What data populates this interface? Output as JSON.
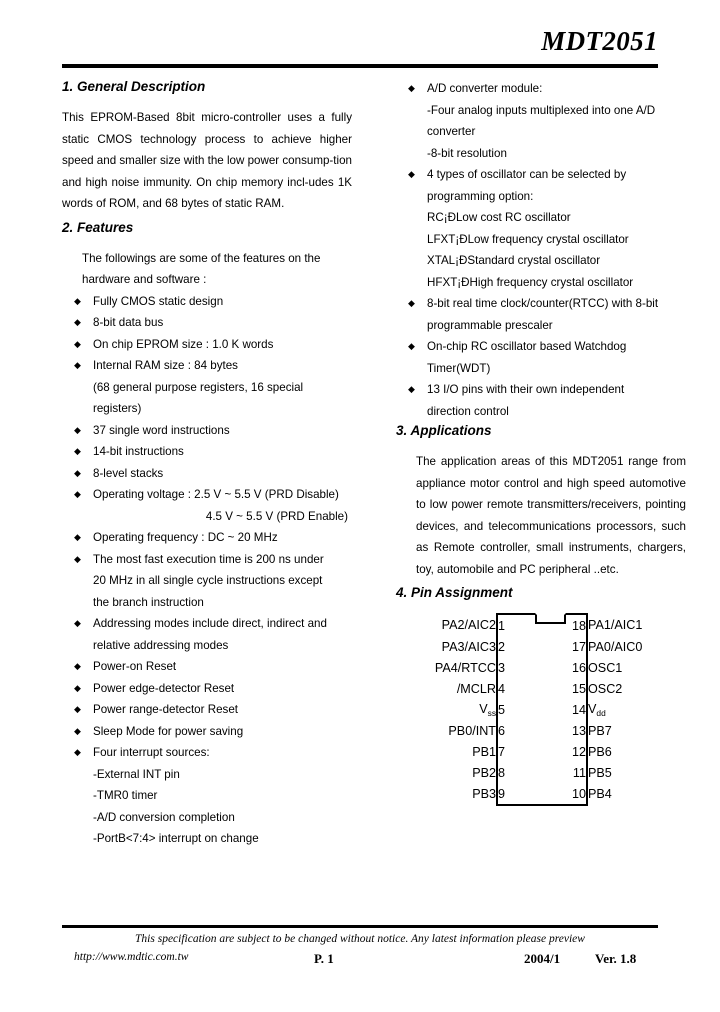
{
  "header": {
    "doc_title": "MDT2051"
  },
  "sections": {
    "general_description": {
      "heading": "1. General Description",
      "paragraph": "This EPROM-Based 8bit micro-controller uses a fully static CMOS technology process to achieve higher speed and smaller size with the low power consump-tion and high noise immunity. On chip memory incl-udes 1K words of ROM, and 68 bytes of static RAM."
    },
    "features": {
      "heading": "2. Features",
      "intro_line1": "The followings are some of the features on the",
      "intro_line2": "hardware and software :",
      "items_left": [
        {
          "type": "bullet",
          "text": "Fully CMOS static design"
        },
        {
          "type": "bullet",
          "text": "8-bit data bus"
        },
        {
          "type": "bullet",
          "text": "On chip EPROM size : 1.0 K words"
        },
        {
          "type": "bullet",
          "text": "Internal RAM size : 84 bytes"
        },
        {
          "type": "sub",
          "text": "(68 general purpose registers, 16 special"
        },
        {
          "type": "sub",
          "text": "registers)"
        },
        {
          "type": "bullet",
          "text": "37 single word instructions"
        },
        {
          "type": "bullet",
          "text": "14-bit instructions"
        },
        {
          "type": "bullet",
          "text": "8-level stacks"
        },
        {
          "type": "bullet",
          "text": "Operating voltage : 2.5 V ~ 5.5 V (PRD Disable)"
        },
        {
          "type": "right",
          "text": "4.5 V ~ 5.5 V (PRD Enable)"
        },
        {
          "type": "bullet",
          "text": "Operating frequency : DC ~ 20 MHz"
        },
        {
          "type": "bullet-justified",
          "text": "The most fast execution time is 200 ns under"
        },
        {
          "type": "cont-justified",
          "text": "20 MHz in all single cycle instructions except"
        },
        {
          "type": "cont",
          "text": "the branch instruction"
        },
        {
          "type": "bullet-justified",
          "text": "Addressing modes include direct, indirect and"
        },
        {
          "type": "cont",
          "text": "relative addressing modes"
        },
        {
          "type": "bullet",
          "text": "Power-on Reset"
        },
        {
          "type": "bullet",
          "text": "Power edge-detector Reset"
        },
        {
          "type": "bullet",
          "text": "Power range-detector Reset"
        },
        {
          "type": "bullet",
          "text": "Sleep Mode for power saving"
        },
        {
          "type": "bullet",
          "text": "Four interrupt sources:"
        },
        {
          "type": "sub",
          "text": "-External INT pin"
        },
        {
          "type": "sub",
          "text": "-TMR0 timer"
        },
        {
          "type": "sub",
          "text": "-A/D conversion completion"
        },
        {
          "type": "sub",
          "text": "-PortB<7:4> interrupt on change"
        }
      ],
      "items_right": [
        {
          "type": "bullet",
          "text": "A/D converter module:"
        },
        {
          "type": "sub",
          "text": "-Four analog inputs multiplexed into one A/D"
        },
        {
          "type": "sub",
          "text": "converter"
        },
        {
          "type": "sub",
          "text": "-8-bit resolution"
        },
        {
          "type": "bullet",
          "text": "4 types of oscillator can be selected by"
        },
        {
          "type": "cont",
          "text": "programming option:"
        },
        {
          "type": "cont",
          "text": "RC¡ÐLow cost RC oscillator"
        },
        {
          "type": "cont",
          "text": "LFXT¡ÐLow frequency crystal oscillator"
        },
        {
          "type": "cont",
          "text": "XTAL¡ÐStandard crystal oscillator"
        },
        {
          "type": "cont",
          "text": "HFXT¡ÐHigh frequency crystal oscillator"
        },
        {
          "type": "bullet",
          "text": "8-bit real time clock/counter(RTCC) with 8-bit"
        },
        {
          "type": "cont",
          "text": "programmable prescaler"
        },
        {
          "type": "bullet",
          "text": "On-chip RC oscillator based Watchdog"
        },
        {
          "type": "cont",
          "text": "Timer(WDT)"
        },
        {
          "type": "bullet",
          "text": "13 I/O pins with their own independent"
        },
        {
          "type": "cont",
          "text": "direction control"
        }
      ]
    },
    "applications": {
      "heading": "3. Applications",
      "paragraph": "The application areas of this MDT2051 range from appliance motor control and high speed automotive to low power remote transmitters/receivers, pointing devices, and telecommunications processors, such as Remote controller, small instruments, chargers, toy, automobile and PC peripheral ..etc."
    },
    "pin_assignment": {
      "heading": "4. Pin Assignment",
      "rows": [
        {
          "left_label": "PA2/AIC2",
          "left_pin": "1",
          "right_pin": "18",
          "right_label": "PA1/AIC1"
        },
        {
          "left_label": "PA3/AIC3",
          "left_pin": "2",
          "right_pin": "17",
          "right_label": "PA0/AIC0"
        },
        {
          "left_label": "PA4/RTCC",
          "left_pin": "3",
          "right_pin": "16",
          "right_label": "OSC1"
        },
        {
          "left_label": "/MCLR",
          "left_pin": "4",
          "right_pin": "15",
          "right_label": "OSC2"
        },
        {
          "left_label": "Vss",
          "left_pin": "5",
          "right_pin": "14",
          "right_label": "Vdd"
        },
        {
          "left_label": "PB0/INT",
          "left_pin": "6",
          "right_pin": "13",
          "right_label": "PB7"
        },
        {
          "left_label": "PB1",
          "left_pin": "7",
          "right_pin": "12",
          "right_label": "PB6"
        },
        {
          "left_label": "PB2",
          "left_pin": "8",
          "right_pin": "11",
          "right_label": "PB5"
        },
        {
          "left_label": "PB3",
          "left_pin": "9",
          "right_pin": "10",
          "right_label": "PB4"
        }
      ]
    }
  },
  "footer": {
    "note": "This specification are subject to be changed without notice. Any latest information  please preview",
    "url": "http://www.mdtic.com.tw",
    "page": "P. 1",
    "date": "2004/1",
    "version": "Ver. 1.8"
  }
}
